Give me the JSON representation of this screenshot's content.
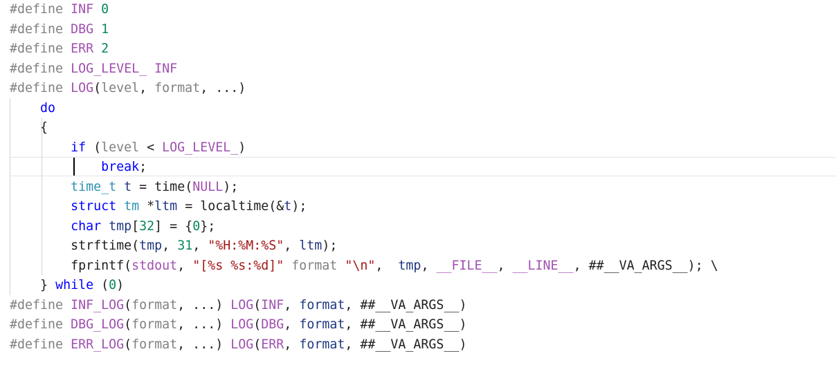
{
  "code_lines": [
    [
      {
        "t": "#define",
        "c": "pp"
      },
      {
        "t": " ",
        "c": "punc"
      },
      {
        "t": "INF",
        "c": "mac"
      },
      {
        "t": " ",
        "c": "punc"
      },
      {
        "t": "0",
        "c": "num"
      }
    ],
    [
      {
        "t": "#define",
        "c": "pp"
      },
      {
        "t": " ",
        "c": "punc"
      },
      {
        "t": "DBG",
        "c": "mac"
      },
      {
        "t": " ",
        "c": "punc"
      },
      {
        "t": "1",
        "c": "num"
      }
    ],
    [
      {
        "t": "#define",
        "c": "pp"
      },
      {
        "t": " ",
        "c": "punc"
      },
      {
        "t": "ERR",
        "c": "mac"
      },
      {
        "t": " ",
        "c": "punc"
      },
      {
        "t": "2",
        "c": "num"
      }
    ],
    [
      {
        "t": "#define",
        "c": "pp"
      },
      {
        "t": " ",
        "c": "punc"
      },
      {
        "t": "LOG_LEVEL_",
        "c": "mac"
      },
      {
        "t": " ",
        "c": "punc"
      },
      {
        "t": "INF",
        "c": "mac"
      }
    ],
    [
      {
        "t": "#define",
        "c": "pp"
      },
      {
        "t": " ",
        "c": "punc"
      },
      {
        "t": "LOG",
        "c": "mac"
      },
      {
        "t": "(",
        "c": "punc"
      },
      {
        "t": "level",
        "c": "param"
      },
      {
        "t": ", ",
        "c": "punc"
      },
      {
        "t": "format",
        "c": "param"
      },
      {
        "t": ", ...)",
        "c": "punc"
      }
    ],
    [
      {
        "t": "    ",
        "c": "punc"
      },
      {
        "t": "do",
        "c": "kw"
      }
    ],
    [
      {
        "t": "    ",
        "c": "punc"
      },
      {
        "t": "{",
        "c": "punc"
      }
    ],
    [
      {
        "t": "        ",
        "c": "punc"
      },
      {
        "t": "if",
        "c": "kw"
      },
      {
        "t": " (",
        "c": "punc"
      },
      {
        "t": "level",
        "c": "param"
      },
      {
        "t": " < ",
        "c": "op"
      },
      {
        "t": "LOG_LEVEL_",
        "c": "mac"
      },
      {
        "t": ")",
        "c": "punc"
      }
    ],
    [
      {
        "t": "            ",
        "c": "punc"
      },
      {
        "t": "break",
        "c": "kw"
      },
      {
        "t": ";",
        "c": "punc"
      }
    ],
    [
      {
        "t": "        ",
        "c": "punc"
      },
      {
        "t": "time_t",
        "c": "type"
      },
      {
        "t": " ",
        "c": "punc"
      },
      {
        "t": "t",
        "c": "var"
      },
      {
        "t": " = ",
        "c": "op"
      },
      {
        "t": "time",
        "c": "fn"
      },
      {
        "t": "(",
        "c": "punc"
      },
      {
        "t": "NULL",
        "c": "mac"
      },
      {
        "t": ");",
        "c": "punc"
      }
    ],
    [
      {
        "t": "        ",
        "c": "punc"
      },
      {
        "t": "struct",
        "c": "kw"
      },
      {
        "t": " ",
        "c": "punc"
      },
      {
        "t": "tm",
        "c": "type"
      },
      {
        "t": " *",
        "c": "op"
      },
      {
        "t": "ltm",
        "c": "var"
      },
      {
        "t": " = ",
        "c": "op"
      },
      {
        "t": "localtime",
        "c": "fn"
      },
      {
        "t": "(&",
        "c": "punc"
      },
      {
        "t": "t",
        "c": "var"
      },
      {
        "t": ");",
        "c": "punc"
      }
    ],
    [
      {
        "t": "        ",
        "c": "punc"
      },
      {
        "t": "char",
        "c": "kw"
      },
      {
        "t": " ",
        "c": "punc"
      },
      {
        "t": "tmp",
        "c": "var"
      },
      {
        "t": "[",
        "c": "punc"
      },
      {
        "t": "32",
        "c": "num"
      },
      {
        "t": "] = {",
        "c": "punc"
      },
      {
        "t": "0",
        "c": "num"
      },
      {
        "t": "};",
        "c": "punc"
      }
    ],
    [
      {
        "t": "        ",
        "c": "punc"
      },
      {
        "t": "strftime",
        "c": "fn"
      },
      {
        "t": "(",
        "c": "punc"
      },
      {
        "t": "tmp",
        "c": "var"
      },
      {
        "t": ", ",
        "c": "punc"
      },
      {
        "t": "31",
        "c": "num"
      },
      {
        "t": ", ",
        "c": "punc"
      },
      {
        "t": "\"%H:%M:%S\"",
        "c": "str"
      },
      {
        "t": ", ",
        "c": "punc"
      },
      {
        "t": "ltm",
        "c": "var"
      },
      {
        "t": ");",
        "c": "punc"
      }
    ],
    [
      {
        "t": "        ",
        "c": "punc"
      },
      {
        "t": "fprintf",
        "c": "fn"
      },
      {
        "t": "(",
        "c": "punc"
      },
      {
        "t": "stdout",
        "c": "mac"
      },
      {
        "t": ", ",
        "c": "punc"
      },
      {
        "t": "\"[%s %s:%d]\"",
        "c": "str"
      },
      {
        "t": " ",
        "c": "punc"
      },
      {
        "t": "format",
        "c": "param"
      },
      {
        "t": " ",
        "c": "punc"
      },
      {
        "t": "\"\\n\"",
        "c": "str"
      },
      {
        "t": ",  ",
        "c": "punc"
      },
      {
        "t": "tmp",
        "c": "var"
      },
      {
        "t": ", ",
        "c": "punc"
      },
      {
        "t": "__FILE__",
        "c": "mac"
      },
      {
        "t": ", ",
        "c": "punc"
      },
      {
        "t": "__LINE__",
        "c": "mac"
      },
      {
        "t": ", ##__VA_ARGS__); \\",
        "c": "punc"
      }
    ],
    [
      {
        "t": "    ",
        "c": "punc"
      },
      {
        "t": "}",
        "c": "punc"
      },
      {
        "t": " ",
        "c": "punc"
      },
      {
        "t": "while",
        "c": "kw"
      },
      {
        "t": " (",
        "c": "punc"
      },
      {
        "t": "0",
        "c": "num"
      },
      {
        "t": ")",
        "c": "punc"
      }
    ],
    [
      {
        "t": "#define",
        "c": "pp"
      },
      {
        "t": " ",
        "c": "punc"
      },
      {
        "t": "INF_LOG",
        "c": "mac"
      },
      {
        "t": "(",
        "c": "punc"
      },
      {
        "t": "format",
        "c": "param"
      },
      {
        "t": ", ...) ",
        "c": "punc"
      },
      {
        "t": "LOG",
        "c": "mac"
      },
      {
        "t": "(",
        "c": "punc"
      },
      {
        "t": "INF",
        "c": "mac"
      },
      {
        "t": ", ",
        "c": "punc"
      },
      {
        "t": "format",
        "c": "var"
      },
      {
        "t": ", ##__VA_ARGS__)",
        "c": "punc"
      }
    ],
    [
      {
        "t": "#define",
        "c": "pp"
      },
      {
        "t": " ",
        "c": "punc"
      },
      {
        "t": "DBG_LOG",
        "c": "mac"
      },
      {
        "t": "(",
        "c": "punc"
      },
      {
        "t": "format",
        "c": "param"
      },
      {
        "t": ", ...) ",
        "c": "punc"
      },
      {
        "t": "LOG",
        "c": "mac"
      },
      {
        "t": "(",
        "c": "punc"
      },
      {
        "t": "DBG",
        "c": "mac"
      },
      {
        "t": ", ",
        "c": "punc"
      },
      {
        "t": "format",
        "c": "var"
      },
      {
        "t": ", ##__VA_ARGS__)",
        "c": "punc"
      }
    ],
    [
      {
        "t": "#define",
        "c": "pp"
      },
      {
        "t": " ",
        "c": "punc"
      },
      {
        "t": "ERR_LOG",
        "c": "mac"
      },
      {
        "t": "(",
        "c": "punc"
      },
      {
        "t": "format",
        "c": "param"
      },
      {
        "t": ", ...) ",
        "c": "punc"
      },
      {
        "t": "LOG",
        "c": "mac"
      },
      {
        "t": "(",
        "c": "punc"
      },
      {
        "t": "ERR",
        "c": "mac"
      },
      {
        "t": ", ",
        "c": "punc"
      },
      {
        "t": "format",
        "c": "var"
      },
      {
        "t": ", ##__VA_ARGS__)",
        "c": "punc"
      }
    ]
  ],
  "editor_state": {
    "active_line": 9,
    "caret_line": 9
  }
}
